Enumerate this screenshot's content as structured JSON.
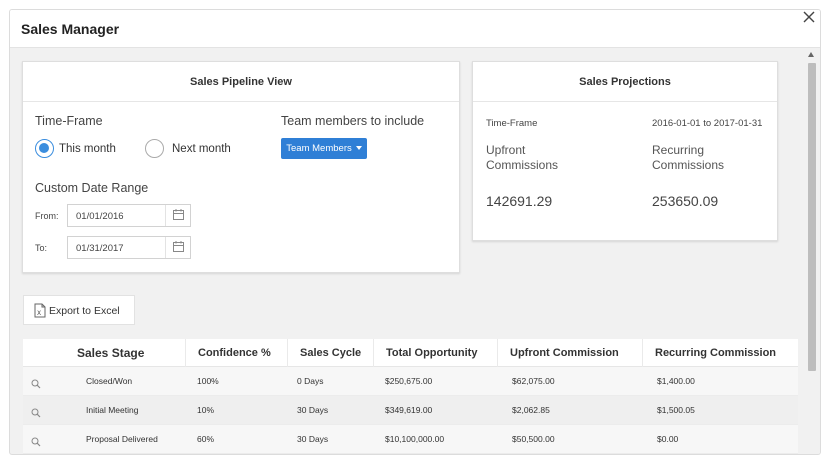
{
  "dialog": {
    "title": "Sales Manager"
  },
  "pipeline": {
    "title": "Sales Pipeline View",
    "timeframe_label": "Time-Frame",
    "radio_this_month": "This month",
    "radio_next_month": "Next month",
    "team_label": "Team members to include",
    "team_button": "Team Members",
    "custom_range_label": "Custom Date Range",
    "from_label": "From:",
    "from_value": "01/01/2016",
    "to_label": "To:",
    "to_value": "01/31/2017"
  },
  "projections": {
    "title": "Sales Projections",
    "timeframe_label": "Time-Frame",
    "timeframe_value": "2016-01-01 to 2017-01-31",
    "upfront_line1": "Upfront",
    "upfront_line2": "Commissions",
    "recurring_line1": "Recurring",
    "recurring_line2": "Commissions",
    "upfront_value": "142691.29",
    "recurring_value": "253650.09"
  },
  "export": {
    "label": "Export to Excel"
  },
  "table": {
    "headers": [
      "Sales Stage",
      "Confidence %",
      "Sales Cycle",
      "Total Opportunity",
      "Upfront Commission",
      "Recurring Commission"
    ],
    "rows": [
      [
        "Closed/Won",
        "100%",
        "0 Days",
        "$250,675.00",
        "$62,075.00",
        "$1,400.00"
      ],
      [
        "Initial Meeting",
        "10%",
        "30 Days",
        "$349,619.00",
        "$2,062.85",
        "$1,500.05"
      ],
      [
        "Proposal Delivered",
        "60%",
        "30 Days",
        "$10,100,000.00",
        "$50,500.00",
        "$0.00"
      ]
    ]
  },
  "colors": {
    "accent": "#2f7fd6",
    "radio_checked": "#3a8dde"
  }
}
